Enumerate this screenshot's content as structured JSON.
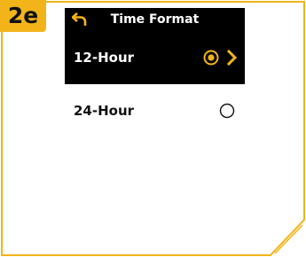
{
  "step_badge": "2e",
  "header": {
    "title": "Time Format",
    "back_icon": "back-arrow-icon"
  },
  "options": [
    {
      "label": "12-Hour",
      "selected": true
    },
    {
      "label": "24-Hour",
      "selected": false
    }
  ],
  "colors": {
    "accent": "#f2b418",
    "screen_bg": "#000000",
    "text_on_dark": "#ffffff"
  }
}
